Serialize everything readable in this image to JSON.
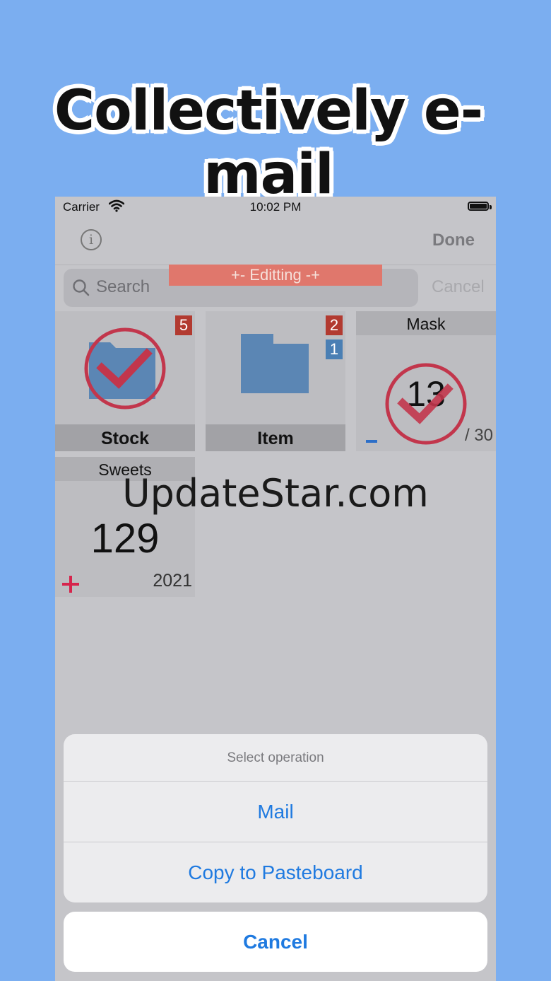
{
  "headline": "Collectively e-mail",
  "status_bar": {
    "carrier": "Carrier",
    "time": "10:02 PM"
  },
  "nav": {
    "done_label": "Done"
  },
  "search": {
    "placeholder": "Search",
    "cancel_label": "Cancel"
  },
  "edit_banner": "+- Editting -+",
  "tiles": [
    {
      "label": "Stock",
      "badge": "5"
    },
    {
      "label": "Item",
      "badges": [
        "2",
        "1"
      ]
    },
    {
      "label": "Mask",
      "value": "13",
      "max": "/ 30"
    },
    {
      "label": "Sweets",
      "value": "129",
      "year": "2021"
    }
  ],
  "watermark": "UpdateStar.com",
  "action_sheet": {
    "title": "Select operation",
    "options": [
      "Mail",
      "Copy to Pasteboard"
    ],
    "cancel_label": "Cancel"
  },
  "colors": {
    "background": "#7BAEF0",
    "accent_blue": "#1F7AE0",
    "badge_red": "#B23A30",
    "badge_blue": "#4A7FB4",
    "check_red": "#C2364C"
  }
}
